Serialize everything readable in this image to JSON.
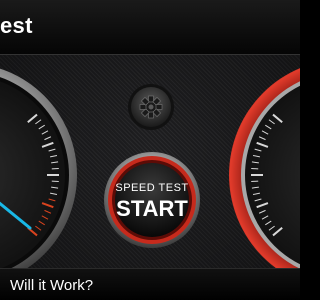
{
  "header": {
    "title": "est"
  },
  "start_button": {
    "label_top": "SPEED TEST",
    "label_main": "START"
  },
  "settings": {
    "icon": "gear-icon"
  },
  "footer": {
    "text": "Will it Work?"
  },
  "colors": {
    "accent": "#e53a2a",
    "needle": "#19b8e6",
    "redline": "#d9431e"
  }
}
